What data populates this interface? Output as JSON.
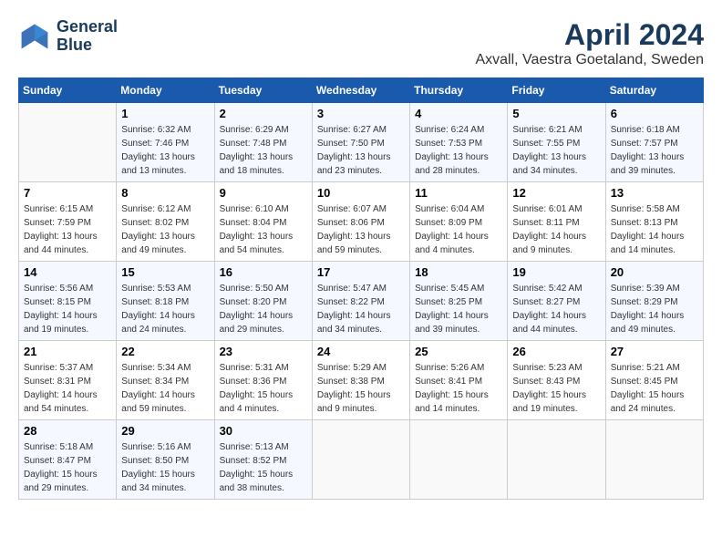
{
  "header": {
    "logo_line1": "General",
    "logo_line2": "Blue",
    "title": "April 2024",
    "subtitle": "Axvall, Vaestra Goetaland, Sweden"
  },
  "calendar": {
    "days_of_week": [
      "Sunday",
      "Monday",
      "Tuesday",
      "Wednesday",
      "Thursday",
      "Friday",
      "Saturday"
    ],
    "weeks": [
      [
        {
          "day": "",
          "sunrise": "",
          "sunset": "",
          "daylight": ""
        },
        {
          "day": "1",
          "sunrise": "Sunrise: 6:32 AM",
          "sunset": "Sunset: 7:46 PM",
          "daylight": "Daylight: 13 hours and 13 minutes."
        },
        {
          "day": "2",
          "sunrise": "Sunrise: 6:29 AM",
          "sunset": "Sunset: 7:48 PM",
          "daylight": "Daylight: 13 hours and 18 minutes."
        },
        {
          "day": "3",
          "sunrise": "Sunrise: 6:27 AM",
          "sunset": "Sunset: 7:50 PM",
          "daylight": "Daylight: 13 hours and 23 minutes."
        },
        {
          "day": "4",
          "sunrise": "Sunrise: 6:24 AM",
          "sunset": "Sunset: 7:53 PM",
          "daylight": "Daylight: 13 hours and 28 minutes."
        },
        {
          "day": "5",
          "sunrise": "Sunrise: 6:21 AM",
          "sunset": "Sunset: 7:55 PM",
          "daylight": "Daylight: 13 hours and 34 minutes."
        },
        {
          "day": "6",
          "sunrise": "Sunrise: 6:18 AM",
          "sunset": "Sunset: 7:57 PM",
          "daylight": "Daylight: 13 hours and 39 minutes."
        }
      ],
      [
        {
          "day": "7",
          "sunrise": "Sunrise: 6:15 AM",
          "sunset": "Sunset: 7:59 PM",
          "daylight": "Daylight: 13 hours and 44 minutes."
        },
        {
          "day": "8",
          "sunrise": "Sunrise: 6:12 AM",
          "sunset": "Sunset: 8:02 PM",
          "daylight": "Daylight: 13 hours and 49 minutes."
        },
        {
          "day": "9",
          "sunrise": "Sunrise: 6:10 AM",
          "sunset": "Sunset: 8:04 PM",
          "daylight": "Daylight: 13 hours and 54 minutes."
        },
        {
          "day": "10",
          "sunrise": "Sunrise: 6:07 AM",
          "sunset": "Sunset: 8:06 PM",
          "daylight": "Daylight: 13 hours and 59 minutes."
        },
        {
          "day": "11",
          "sunrise": "Sunrise: 6:04 AM",
          "sunset": "Sunset: 8:09 PM",
          "daylight": "Daylight: 14 hours and 4 minutes."
        },
        {
          "day": "12",
          "sunrise": "Sunrise: 6:01 AM",
          "sunset": "Sunset: 8:11 PM",
          "daylight": "Daylight: 14 hours and 9 minutes."
        },
        {
          "day": "13",
          "sunrise": "Sunrise: 5:58 AM",
          "sunset": "Sunset: 8:13 PM",
          "daylight": "Daylight: 14 hours and 14 minutes."
        }
      ],
      [
        {
          "day": "14",
          "sunrise": "Sunrise: 5:56 AM",
          "sunset": "Sunset: 8:15 PM",
          "daylight": "Daylight: 14 hours and 19 minutes."
        },
        {
          "day": "15",
          "sunrise": "Sunrise: 5:53 AM",
          "sunset": "Sunset: 8:18 PM",
          "daylight": "Daylight: 14 hours and 24 minutes."
        },
        {
          "day": "16",
          "sunrise": "Sunrise: 5:50 AM",
          "sunset": "Sunset: 8:20 PM",
          "daylight": "Daylight: 14 hours and 29 minutes."
        },
        {
          "day": "17",
          "sunrise": "Sunrise: 5:47 AM",
          "sunset": "Sunset: 8:22 PM",
          "daylight": "Daylight: 14 hours and 34 minutes."
        },
        {
          "day": "18",
          "sunrise": "Sunrise: 5:45 AM",
          "sunset": "Sunset: 8:25 PM",
          "daylight": "Daylight: 14 hours and 39 minutes."
        },
        {
          "day": "19",
          "sunrise": "Sunrise: 5:42 AM",
          "sunset": "Sunset: 8:27 PM",
          "daylight": "Daylight: 14 hours and 44 minutes."
        },
        {
          "day": "20",
          "sunrise": "Sunrise: 5:39 AM",
          "sunset": "Sunset: 8:29 PM",
          "daylight": "Daylight: 14 hours and 49 minutes."
        }
      ],
      [
        {
          "day": "21",
          "sunrise": "Sunrise: 5:37 AM",
          "sunset": "Sunset: 8:31 PM",
          "daylight": "Daylight: 14 hours and 54 minutes."
        },
        {
          "day": "22",
          "sunrise": "Sunrise: 5:34 AM",
          "sunset": "Sunset: 8:34 PM",
          "daylight": "Daylight: 14 hours and 59 minutes."
        },
        {
          "day": "23",
          "sunrise": "Sunrise: 5:31 AM",
          "sunset": "Sunset: 8:36 PM",
          "daylight": "Daylight: 15 hours and 4 minutes."
        },
        {
          "day": "24",
          "sunrise": "Sunrise: 5:29 AM",
          "sunset": "Sunset: 8:38 PM",
          "daylight": "Daylight: 15 hours and 9 minutes."
        },
        {
          "day": "25",
          "sunrise": "Sunrise: 5:26 AM",
          "sunset": "Sunset: 8:41 PM",
          "daylight": "Daylight: 15 hours and 14 minutes."
        },
        {
          "day": "26",
          "sunrise": "Sunrise: 5:23 AM",
          "sunset": "Sunset: 8:43 PM",
          "daylight": "Daylight: 15 hours and 19 minutes."
        },
        {
          "day": "27",
          "sunrise": "Sunrise: 5:21 AM",
          "sunset": "Sunset: 8:45 PM",
          "daylight": "Daylight: 15 hours and 24 minutes."
        }
      ],
      [
        {
          "day": "28",
          "sunrise": "Sunrise: 5:18 AM",
          "sunset": "Sunset: 8:47 PM",
          "daylight": "Daylight: 15 hours and 29 minutes."
        },
        {
          "day": "29",
          "sunrise": "Sunrise: 5:16 AM",
          "sunset": "Sunset: 8:50 PM",
          "daylight": "Daylight: 15 hours and 34 minutes."
        },
        {
          "day": "30",
          "sunrise": "Sunrise: 5:13 AM",
          "sunset": "Sunset: 8:52 PM",
          "daylight": "Daylight: 15 hours and 38 minutes."
        },
        {
          "day": "",
          "sunrise": "",
          "sunset": "",
          "daylight": ""
        },
        {
          "day": "",
          "sunrise": "",
          "sunset": "",
          "daylight": ""
        },
        {
          "day": "",
          "sunrise": "",
          "sunset": "",
          "daylight": ""
        },
        {
          "day": "",
          "sunrise": "",
          "sunset": "",
          "daylight": ""
        }
      ]
    ]
  }
}
